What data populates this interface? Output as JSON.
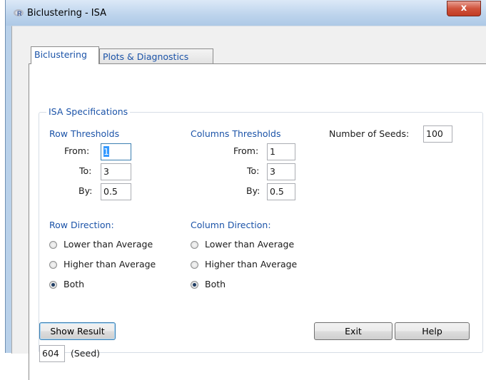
{
  "window": {
    "title": "Biclustering - ISA",
    "close_glyph": "x"
  },
  "tabs": [
    {
      "label": "Biclustering"
    },
    {
      "label": "Plots & Diagnostics"
    }
  ],
  "isa": {
    "group_title": "ISA Specifications",
    "row_thresholds": {
      "title": "Row Thresholds",
      "from_label": "From:",
      "from_value": "1",
      "to_label": "To:",
      "to_value": "3",
      "by_label": "By:",
      "by_value": "0.5"
    },
    "col_thresholds": {
      "title": "Columns Thresholds",
      "from_label": "From:",
      "from_value": "1",
      "to_label": "To:",
      "to_value": "3",
      "by_label": "By:",
      "by_value": "0.5"
    },
    "seeds": {
      "label": "Number of Seeds:",
      "value": "100"
    },
    "row_direction": {
      "title": "Row Direction:",
      "options": [
        "Lower than Average",
        "Higher than Average",
        "Both"
      ],
      "selected": "Both"
    },
    "col_direction": {
      "title": "Column Direction:",
      "options": [
        "Lower than Average",
        "Higher than Average",
        "Both"
      ],
      "selected": "Both"
    }
  },
  "buttons": {
    "show_result": "Show Result",
    "exit": "Exit",
    "help": "Help"
  },
  "seed_result": {
    "value": "604",
    "label": "(Seed)"
  }
}
